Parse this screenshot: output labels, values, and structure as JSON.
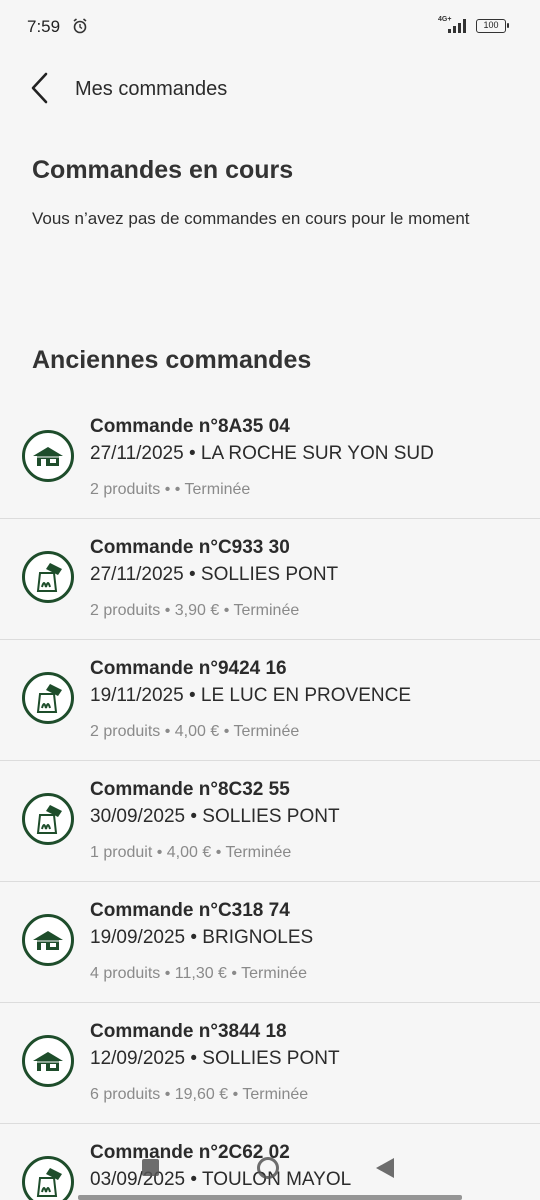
{
  "status_bar": {
    "time": "7:59",
    "network": "4G+",
    "battery": "100"
  },
  "header": {
    "title": "Mes commandes"
  },
  "current_orders": {
    "title": "Commandes en cours",
    "empty_message": "Vous n’avez pas de commandes en cours pour le moment"
  },
  "past_orders": {
    "title": "Anciennes commandes",
    "items": [
      {
        "number": "Commande n°8A35 04",
        "date_store": "27/11/2025 • LA ROCHE SUR YON SUD",
        "meta": "2 produits •  • Terminée",
        "icon": "restaurant-icon"
      },
      {
        "number": "Commande n°C933 30",
        "date_store": "27/11/2025 • SOLLIES PONT",
        "meta": "2 produits • 3,90 € • Terminée",
        "icon": "takeaway-bag-icon"
      },
      {
        "number": "Commande n°9424 16",
        "date_store": "19/11/2025 • LE LUC EN PROVENCE",
        "meta": "2 produits • 4,00 € • Terminée",
        "icon": "takeaway-bag-icon"
      },
      {
        "number": "Commande n°8C32 55",
        "date_store": "30/09/2025 • SOLLIES PONT",
        "meta": "1 produit • 4,00 € • Terminée",
        "icon": "takeaway-bag-icon"
      },
      {
        "number": "Commande n°C318 74",
        "date_store": "19/09/2025 • BRIGNOLES",
        "meta": "4 produits • 11,30 € • Terminée",
        "icon": "restaurant-icon"
      },
      {
        "number": "Commande n°3844 18",
        "date_store": "12/09/2025 • SOLLIES PONT",
        "meta": "6 produits • 19,60 € • Terminée",
        "icon": "restaurant-icon"
      },
      {
        "number": "Commande n°2C62 02",
        "date_store": "03/09/2025 • TOULON MAYOL",
        "meta": "",
        "icon": "takeaway-bag-icon"
      }
    ]
  },
  "colors": {
    "accent": "#1e4d2b",
    "background": "#f6f6f6",
    "meta_text": "#8a8a8a"
  }
}
